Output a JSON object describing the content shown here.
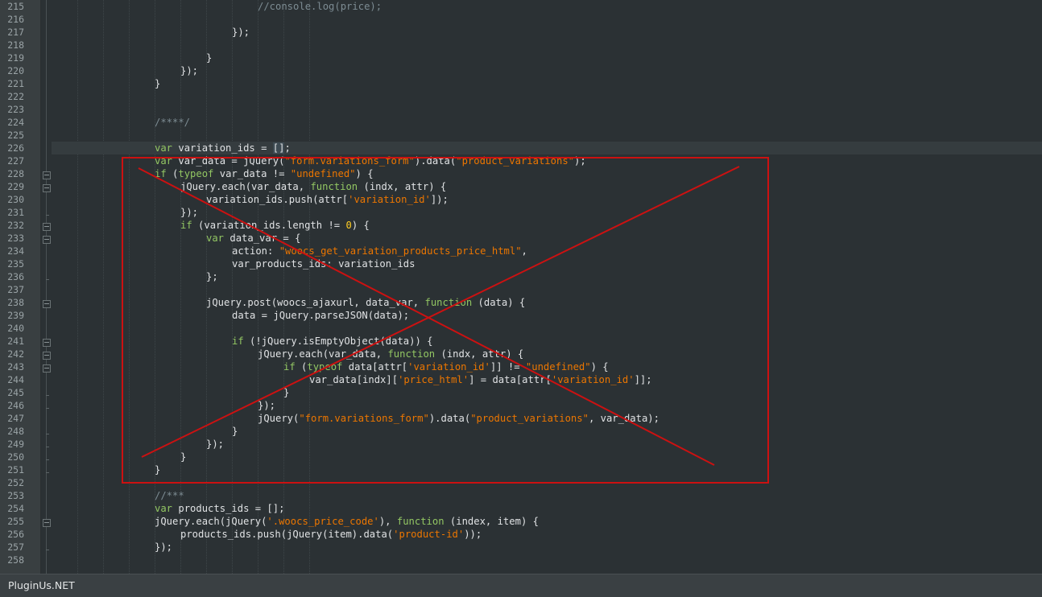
{
  "editor": {
    "lines": [
      {
        "num": "215",
        "indent": 8,
        "tokens": [
          {
            "t": "//console.log(price);",
            "c": "c"
          }
        ]
      },
      {
        "num": "216",
        "indent": 0,
        "tokens": []
      },
      {
        "num": "217",
        "indent": 7,
        "tokens": [
          {
            "t": "});"
          }
        ]
      },
      {
        "num": "218",
        "indent": 0,
        "tokens": []
      },
      {
        "num": "219",
        "indent": 6,
        "tokens": [
          {
            "t": "}"
          }
        ]
      },
      {
        "num": "220",
        "indent": 5,
        "tokens": [
          {
            "t": "});"
          }
        ]
      },
      {
        "num": "221",
        "indent": 4,
        "tokens": [
          {
            "t": "}"
          }
        ]
      },
      {
        "num": "222",
        "indent": 0,
        "tokens": []
      },
      {
        "num": "223",
        "indent": 0,
        "tokens": []
      },
      {
        "num": "224",
        "indent": 4,
        "tokens": [
          {
            "t": "/****/",
            "c": "c"
          }
        ]
      },
      {
        "num": "225",
        "indent": 0,
        "tokens": []
      },
      {
        "num": "226",
        "indent": 4,
        "current": true,
        "tokens": [
          {
            "t": "var",
            "c": "k"
          },
          {
            "t": " variation_ids = "
          },
          {
            "t": "[]",
            "hl": true
          },
          {
            "t": ";"
          }
        ]
      },
      {
        "num": "227",
        "indent": 4,
        "tokens": [
          {
            "t": "var",
            "c": "k"
          },
          {
            "t": " var_data = jQuery("
          },
          {
            "t": "\"form.variations_form\"",
            "c": "s"
          },
          {
            "t": ").data("
          },
          {
            "t": "\"product_variations\"",
            "c": "s"
          },
          {
            "t": ");"
          }
        ]
      },
      {
        "num": "228",
        "indent": 4,
        "fold": true,
        "tokens": [
          {
            "t": "if",
            "c": "k"
          },
          {
            "t": " ("
          },
          {
            "t": "typeof",
            "c": "k"
          },
          {
            "t": " var_data != "
          },
          {
            "t": "\"undefined\"",
            "c": "s"
          },
          {
            "t": ") {"
          }
        ]
      },
      {
        "num": "229",
        "indent": 5,
        "fold": true,
        "tokens": [
          {
            "t": "jQuery.each(var_data, "
          },
          {
            "t": "function",
            "c": "k"
          },
          {
            "t": " (indx, attr) {"
          }
        ]
      },
      {
        "num": "230",
        "indent": 6,
        "tokens": [
          {
            "t": "variation_ids.push(attr["
          },
          {
            "t": "'variation_id'",
            "c": "s"
          },
          {
            "t": "]);"
          }
        ]
      },
      {
        "num": "231",
        "indent": 5,
        "foldend": true,
        "tokens": [
          {
            "t": "});"
          }
        ]
      },
      {
        "num": "232",
        "indent": 5,
        "fold": true,
        "tokens": [
          {
            "t": "if",
            "c": "k"
          },
          {
            "t": " (variation_ids.length != "
          },
          {
            "t": "0",
            "c": "n"
          },
          {
            "t": ") {"
          }
        ]
      },
      {
        "num": "233",
        "indent": 6,
        "fold": true,
        "tokens": [
          {
            "t": "var",
            "c": "k"
          },
          {
            "t": " data_var = {"
          }
        ]
      },
      {
        "num": "234",
        "indent": 7,
        "tokens": [
          {
            "t": "action: "
          },
          {
            "t": "\"woocs_get_variation_products_price_html\"",
            "c": "s"
          },
          {
            "t": ","
          }
        ]
      },
      {
        "num": "235",
        "indent": 7,
        "tokens": [
          {
            "t": "var_products_ids: variation_ids"
          }
        ]
      },
      {
        "num": "236",
        "indent": 6,
        "foldend": true,
        "tokens": [
          {
            "t": "};"
          }
        ]
      },
      {
        "num": "237",
        "indent": 0,
        "tokens": []
      },
      {
        "num": "238",
        "indent": 6,
        "fold": true,
        "tokens": [
          {
            "t": "jQuery.post(woocs_ajaxurl, data_var, "
          },
          {
            "t": "function",
            "c": "k"
          },
          {
            "t": " (data) {"
          }
        ]
      },
      {
        "num": "239",
        "indent": 7,
        "tokens": [
          {
            "t": "data = jQuery.parseJSON(data);"
          }
        ]
      },
      {
        "num": "240",
        "indent": 0,
        "tokens": []
      },
      {
        "num": "241",
        "indent": 7,
        "fold": true,
        "tokens": [
          {
            "t": "if",
            "c": "k"
          },
          {
            "t": " (!jQuery.isEmptyObject(data)) {"
          }
        ]
      },
      {
        "num": "242",
        "indent": 8,
        "fold": true,
        "tokens": [
          {
            "t": "jQuery.each(var_data, "
          },
          {
            "t": "function",
            "c": "k"
          },
          {
            "t": " (indx, attr) {"
          }
        ]
      },
      {
        "num": "243",
        "indent": 9,
        "fold": true,
        "tokens": [
          {
            "t": "if",
            "c": "k"
          },
          {
            "t": " ("
          },
          {
            "t": "typeof",
            "c": "k"
          },
          {
            "t": " data[attr["
          },
          {
            "t": "'variation_id'",
            "c": "s"
          },
          {
            "t": "]] != "
          },
          {
            "t": "\"undefined\"",
            "c": "s"
          },
          {
            "t": ") {"
          }
        ]
      },
      {
        "num": "244",
        "indent": 10,
        "tokens": [
          {
            "t": "var_data[indx]["
          },
          {
            "t": "'price_html'",
            "c": "s"
          },
          {
            "t": "] = data[attr["
          },
          {
            "t": "'variation_id'",
            "c": "s"
          },
          {
            "t": "]];"
          }
        ]
      },
      {
        "num": "245",
        "indent": 9,
        "foldend": true,
        "tokens": [
          {
            "t": "}"
          }
        ]
      },
      {
        "num": "246",
        "indent": 8,
        "foldend": true,
        "tokens": [
          {
            "t": "});"
          }
        ]
      },
      {
        "num": "247",
        "indent": 8,
        "tokens": [
          {
            "t": "jQuery("
          },
          {
            "t": "\"form.variations_form\"",
            "c": "s"
          },
          {
            "t": ").data("
          },
          {
            "t": "\"product_variations\"",
            "c": "s"
          },
          {
            "t": ", var_data);"
          }
        ]
      },
      {
        "num": "248",
        "indent": 7,
        "foldend": true,
        "tokens": [
          {
            "t": "}"
          }
        ]
      },
      {
        "num": "249",
        "indent": 6,
        "foldend": true,
        "tokens": [
          {
            "t": "});"
          }
        ]
      },
      {
        "num": "250",
        "indent": 5,
        "foldend": true,
        "tokens": [
          {
            "t": "}"
          }
        ]
      },
      {
        "num": "251",
        "indent": 4,
        "foldend": true,
        "tokens": [
          {
            "t": "}"
          }
        ]
      },
      {
        "num": "252",
        "indent": 0,
        "tokens": []
      },
      {
        "num": "253",
        "indent": 4,
        "tokens": [
          {
            "t": "//***",
            "c": "c"
          }
        ]
      },
      {
        "num": "254",
        "indent": 4,
        "tokens": [
          {
            "t": "var",
            "c": "k"
          },
          {
            "t": " products_ids = [];"
          }
        ]
      },
      {
        "num": "255",
        "indent": 4,
        "fold": true,
        "tokens": [
          {
            "t": "jQuery.each(jQuery("
          },
          {
            "t": "'.woocs_price_code'",
            "c": "s"
          },
          {
            "t": "), "
          },
          {
            "t": "function",
            "c": "k"
          },
          {
            "t": " (index, item) {"
          }
        ]
      },
      {
        "num": "256",
        "indent": 5,
        "tokens": [
          {
            "t": "products_ids.push(jQuery(item).data("
          },
          {
            "t": "'product-id'",
            "c": "s"
          },
          {
            "t": "));"
          }
        ]
      },
      {
        "num": "257",
        "indent": 4,
        "foldend": true,
        "tokens": [
          {
            "t": "});"
          }
        ]
      },
      {
        "num": "258",
        "indent": 0,
        "tokens": []
      }
    ]
  },
  "annotation": {
    "color": "#cc1111"
  },
  "footer": {
    "brand": "PluginUs.NET"
  }
}
